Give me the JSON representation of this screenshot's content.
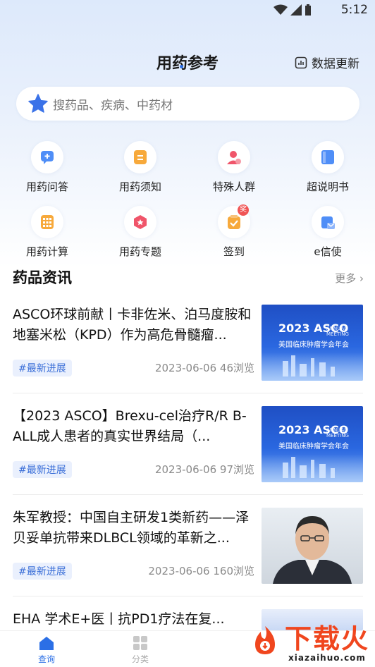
{
  "status_bar": {
    "time": "5:12"
  },
  "header": {
    "title": "用药参考",
    "update_label": "数据更新"
  },
  "search": {
    "placeholder": "搜药品、疾病、中药材"
  },
  "quick_grid": [
    {
      "label": "用药问答",
      "icon": "chat-icon",
      "color": "#4f8ef7"
    },
    {
      "label": "用药须知",
      "icon": "note-icon",
      "color": "#f7a93b"
    },
    {
      "label": "特殊人群",
      "icon": "person-icon",
      "color": "#f0556a"
    },
    {
      "label": "超说明书",
      "icon": "book-icon",
      "color": "#4f8ef7"
    },
    {
      "label": "用药计算",
      "icon": "calculator-icon",
      "color": "#f7a93b"
    },
    {
      "label": "用药专题",
      "icon": "topic-icon",
      "color": "#f0556a"
    },
    {
      "label": "签到",
      "icon": "checkin-icon",
      "color": "#f7a93b",
      "badge": "奖"
    },
    {
      "label": "e信使",
      "icon": "envelope-icon",
      "color": "#4f8ef7"
    }
  ],
  "news_section": {
    "title": "药品资讯",
    "more": "更多",
    "items": [
      {
        "title": "ASCO环球前献丨卡非佐米、泊马度胺和地塞米松（KPD）作为高危骨髓瘤...",
        "tag": "#最新进展",
        "date": "2023-06-06",
        "views": "46浏览",
        "thumb": "asco"
      },
      {
        "title": "【2023 ASCO】Brexu-cel治疗R/R B-ALL成人患者的真实世界结局（...",
        "tag": "#最新进展",
        "date": "2023-06-06",
        "views": "97浏览",
        "thumb": "asco"
      },
      {
        "title": "朱军教授：中国自主研发1类新药——泽贝妥单抗带来DLBCL领域的革新之...",
        "tag": "#最新进展",
        "date": "2023-06-06",
        "views": "160浏览",
        "thumb": "portrait"
      },
      {
        "title": "EHA 学术E+医丨抗PD1疗法在复...",
        "tag": "",
        "date": "",
        "views": "",
        "thumb": "asco"
      }
    ]
  },
  "asco_thumb": {
    "main": "2023 ASCO",
    "sub": "ANNUAL MEETING",
    "cn": "美国临床肿瘤学会年会"
  },
  "tabbar": [
    {
      "label": "查询",
      "active": true
    },
    {
      "label": "分类",
      "active": false
    }
  ],
  "watermark": {
    "main": "下载火",
    "sub": "xiazaihuo.com"
  },
  "colors": {
    "accent": "#2b6fe6",
    "tag_bg": "#eaf0fd",
    "tag_text": "#3b6fd8"
  }
}
